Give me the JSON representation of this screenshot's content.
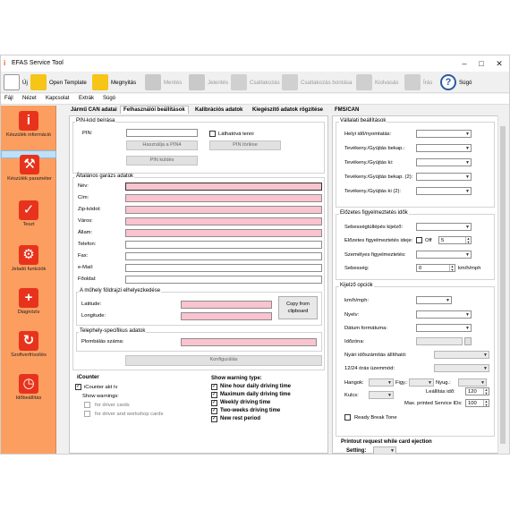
{
  "window": {
    "title": "EFAS Service Tool"
  },
  "toolbar": {
    "new": "Új",
    "open_template": "Open Template",
    "open": "Megnyitás",
    "save": "Mentés",
    "report": "Jelentés",
    "connect": "Csatlakozás",
    "disconnect": "Csatlakozás bontása",
    "read": "Kiolvasás",
    "write": "Írás",
    "help": "Súgó"
  },
  "menu": [
    "Fájl",
    "Nézet",
    "Kapcsolat",
    "Extrák",
    "Súgó"
  ],
  "nav": [
    {
      "label": "Készülék információ"
    },
    {
      "label": "Készülék paraméter"
    },
    {
      "label": "Teszt"
    },
    {
      "label": "Jeladó funkciók"
    },
    {
      "label": "Diagnózis"
    },
    {
      "label": "Szoftverfrissítés"
    },
    {
      "label": "Időbeállítás"
    }
  ],
  "tabs": [
    "Jármű CAN adatai",
    "Felhasználói beállítások",
    "Kalibrációs adatok",
    "Kiegészítő adatok rögzítése",
    "FMS/CAN"
  ],
  "pin": {
    "group": "PIN-kód beírása",
    "pin_label": "PIN:",
    "visible_label": "Láthatóvá tenni",
    "btn_use_pin4": "Használja a PIN4",
    "btn_delete_pin": "PIN törlése",
    "btn_send_pin": "PIN küldés"
  },
  "garage": {
    "group": "Általános garázs adatok",
    "fields": [
      "Név:",
      "Cím:",
      "Zip-kódot:",
      "Város:",
      "Állam:",
      "Telefon:",
      "Fax:",
      "e-Mail:",
      "Főoldal:"
    ],
    "location_group": "A műhely földrajzi elhelyezkedése",
    "latitude": "Latitude:",
    "longitude": "Longitude:",
    "copy_btn": "Copy from clipboard",
    "site_group": "Telephely-specifikus adatok",
    "seal_label": "Plombálás száma:",
    "configure_btn": "Konfigurálás"
  },
  "icounter": {
    "title": "iCounter",
    "active_label": "iCounter akt ív",
    "show_warnings": "Show warnings:",
    "for_driver_cards": "for driver cards",
    "for_driver_workshop": "for driver and workshop cards",
    "warning_type_title": "Show warning type:",
    "warning_types": [
      "Nine hour daily driving time",
      "Maximum daily driving time",
      "Weekly driving time",
      "Two-weeks driving time",
      "New rest period"
    ]
  },
  "company": {
    "group": "Vállalati beállítások",
    "fields": [
      "Helyi idő/nyomtatás:",
      "Tevékeny./Gyújtás bekap.:",
      "Tevékeny./Gyújtás ki:",
      "Tevékeny./Gyújtás bekap. (2):",
      "Tevékeny./Gyújtás ki (2):"
    ]
  },
  "prewarning": {
    "group": "Előzetes figyelmeztetés idők",
    "overspeed": "Sebességtúllépés kijelző:",
    "prewarn_time": "Előzetes figyelmeztetés ideje:",
    "off_label": "Off",
    "prewarn_value": "5",
    "personal": "Személyes figyelmeztetés:",
    "speed": "Sebesség:",
    "speed_value": "0",
    "speed_unit": "km/h/mph"
  },
  "display": {
    "group": "Kijelző opciók",
    "kmh": "km/h/mph:",
    "language": "Nyelv:",
    "date_format": "Dátum formátuma:",
    "timezone": "Időzóna:",
    "daylight": "Nyári időszámítás állítható:",
    "hour_mode": "12/24 órás üzemmód:",
    "hangok": "Hangok:",
    "figy": "Figy.:",
    "nyug": "Nyug.:",
    "kulcs": "Kulcs:",
    "idle_time": "Leállítás idő:",
    "idle_value": "120",
    "max_printed": "Max. printed Service IDs:",
    "max_value": "100",
    "ready_break": "Ready Break Tone"
  },
  "printout": {
    "title": "Printout request while card ejection",
    "setting": "Setting:"
  },
  "colors": {
    "accent_nav": "#fc9e60",
    "required_field": "#f9c3cf",
    "nav_selected": "#bfe0f7"
  }
}
